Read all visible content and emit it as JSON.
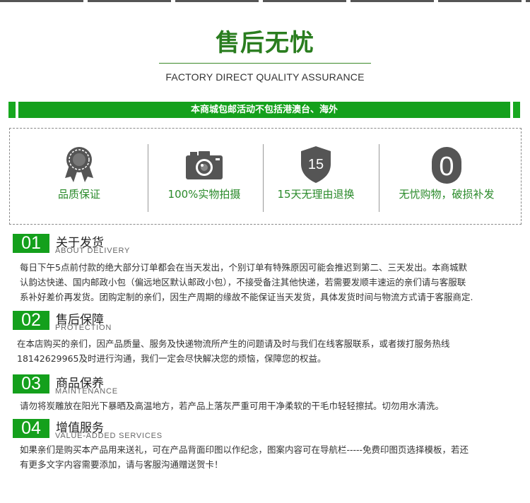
{
  "header": {
    "title": "售后无忧",
    "subtitle": "FACTORY DIRECT QUALITY ASSURANCE"
  },
  "banner": {
    "text": "本商城包邮活动不包括港澳台、海外"
  },
  "features": [
    {
      "icon": "award-medal-icon",
      "label": "品质保证"
    },
    {
      "icon": "camera-icon",
      "label": "100%实物拍摄"
    },
    {
      "icon": "shield-15-icon",
      "badge": "15",
      "label": "15天无理由退换"
    },
    {
      "icon": "zero-circle-icon",
      "badge": "0",
      "label": "无忧购物，破损补发"
    }
  ],
  "sections": [
    {
      "num": "01",
      "title": "关于发货",
      "subtitle": "ABOUT DELIVERY",
      "lines": [
        "每日下午5点前付款的绝大部分订单都会在当天发出，个别订单有特殊原因可能会推迟到第二、三天发出。本商城默",
        "认韵达快递、国内邮政小包（偏远地区默认邮政小包），不接受备注其他快递，若需要发顺丰速运的亲们请与客服联",
        "系补好差价再发货。团购定制的亲们，因生产周期的缘故不能保证当天发货，具体发货时间与物流方式请于客服商定."
      ]
    },
    {
      "num": "02",
      "title": "售后保障",
      "subtitle": "PROTECTION",
      "lines": [
        "在本店购买的亲们，因产品质量、服务及快递物流所产生的问题请及时与我们在线客服联系，或者拨打服务热线",
        "18142629965及时进行沟通，我们一定会尽快解决您的烦恼，保障您的权益。"
      ]
    },
    {
      "num": "03",
      "title": "商品保养",
      "subtitle": "MAINTENANCE",
      "lines": [
        "请勿将炭雕放在阳光下暴晒及高温地方，若产品上落灰严重可用干净柔软的干毛巾轻轻擦拭。切勿用水清洗。"
      ]
    },
    {
      "num": "04",
      "title": "增值服务",
      "subtitle": "VALUE-ADDED SERVICES",
      "lines": [
        "如果亲们是购买本产品用来送礼，可在产品背面印图以作纪念，图案内容可在导航栏-----免费印图页选择模板，若还",
        "有更多文字内容需要添加，请与客服沟通赠送贺卡！"
      ]
    }
  ],
  "colors": {
    "accent_green": "#14a01c",
    "title_green": "#2a7d1f",
    "icon_gray": "#555555"
  }
}
